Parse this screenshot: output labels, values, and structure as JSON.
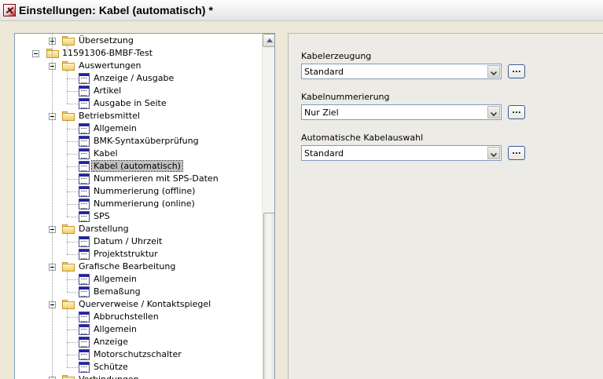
{
  "window": {
    "title": "Einstellungen: Kabel (automatisch) *",
    "app_icon": "eplan-settings-icon"
  },
  "tree": {
    "items": [
      {
        "label": "Übersetzung",
        "type": "folder",
        "expanded": false,
        "level": 2
      },
      {
        "label": "11591306-BMBF-Test",
        "type": "folder",
        "expanded": true,
        "level": 1
      },
      {
        "label": "Auswertungen",
        "type": "folder",
        "expanded": true,
        "level": 2
      },
      {
        "label": "Anzeige / Ausgabe",
        "type": "page",
        "level": 3
      },
      {
        "label": "Artikel",
        "type": "page",
        "level": 3
      },
      {
        "label": "Ausgabe in Seite",
        "type": "page",
        "level": 3
      },
      {
        "label": "Betriebsmittel",
        "type": "folder",
        "expanded": true,
        "level": 2
      },
      {
        "label": "Allgemein",
        "type": "page",
        "level": 3
      },
      {
        "label": "BMK-Syntaxüberprüfung",
        "type": "page",
        "level": 3
      },
      {
        "label": "Kabel",
        "type": "page",
        "level": 3
      },
      {
        "label": "Kabel (automatisch)",
        "type": "page",
        "level": 3,
        "selected": true
      },
      {
        "label": "Nummerieren mit SPS-Daten",
        "type": "page",
        "level": 3
      },
      {
        "label": "Nummerierung (offline)",
        "type": "page",
        "level": 3
      },
      {
        "label": "Nummerierung (online)",
        "type": "page",
        "level": 3
      },
      {
        "label": "SPS",
        "type": "page",
        "level": 3
      },
      {
        "label": "Darstellung",
        "type": "folder",
        "expanded": true,
        "level": 2
      },
      {
        "label": "Datum / Uhrzeit",
        "type": "page",
        "level": 3
      },
      {
        "label": "Projektstruktur",
        "type": "page",
        "level": 3
      },
      {
        "label": "Grafische Bearbeitung",
        "type": "folder",
        "expanded": true,
        "level": 2
      },
      {
        "label": "Allgemein",
        "type": "page",
        "level": 3
      },
      {
        "label": "Bemaßung",
        "type": "page",
        "level": 3
      },
      {
        "label": "Querverweise / Kontaktspiegel",
        "type": "folder",
        "expanded": true,
        "level": 2
      },
      {
        "label": "Abbruchstellen",
        "type": "page",
        "level": 3
      },
      {
        "label": "Allgemein",
        "type": "page",
        "level": 3
      },
      {
        "label": "Anzeige",
        "type": "page",
        "level": 3
      },
      {
        "label": "Motorschutzschalter",
        "type": "page",
        "level": 3
      },
      {
        "label": "Schütze",
        "type": "page",
        "level": 3
      },
      {
        "label": "Verbindungen",
        "type": "folder",
        "expanded": true,
        "level": 2
      }
    ]
  },
  "settings": {
    "kabelerzeugung": {
      "label": "Kabelerzeugung",
      "value": "Standard"
    },
    "kabelnummerierung": {
      "label": "Kabelnummerierung",
      "value": "Nur Ziel"
    },
    "kabelauswahl": {
      "label": "Automatische Kabelauswahl",
      "value": "Standard"
    },
    "ellipsis_label": "..."
  }
}
